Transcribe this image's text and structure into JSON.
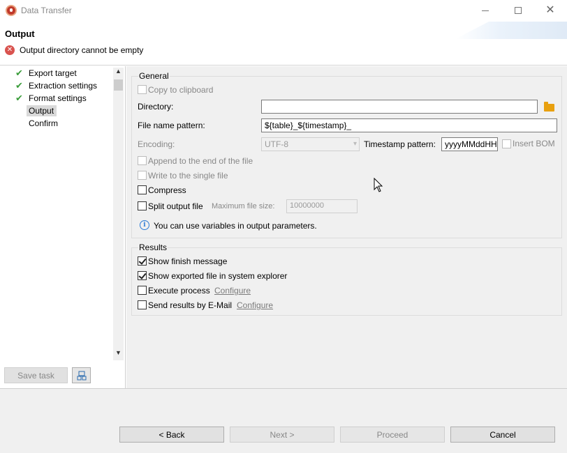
{
  "window": {
    "title": "Data Transfer"
  },
  "header": {
    "title": "Output",
    "error_message": "Output directory cannot be empty"
  },
  "nav": {
    "items": [
      {
        "label": "Export target",
        "checked": true,
        "selected": false
      },
      {
        "label": "Extraction settings",
        "checked": true,
        "selected": false
      },
      {
        "label": "Format settings",
        "checked": true,
        "selected": false
      },
      {
        "label": "Output",
        "checked": false,
        "selected": true
      },
      {
        "label": "Confirm",
        "checked": false,
        "selected": false
      }
    ]
  },
  "left_buttons": {
    "save_task": "Save task"
  },
  "general": {
    "title": "General",
    "copy_to_clipboard": "Copy to clipboard",
    "directory_label": "Directory:",
    "directory_value": "",
    "file_name_pattern_label": "File name pattern:",
    "file_name_pattern_value": "${table}_${timestamp}_",
    "encoding_label": "Encoding:",
    "encoding_value": "UTF-8",
    "timestamp_pattern_label": "Timestamp pattern:",
    "timestamp_pattern_value": "yyyyMMddHH",
    "insert_bom": "Insert BOM",
    "append_to_end": "Append to the end of the file",
    "write_single_file": "Write to the single file",
    "compress": "Compress",
    "split_output_file": "Split output file",
    "max_file_size_label": "Maximum file size:",
    "max_file_size_value": "10000000",
    "info_text": "You can use variables in output parameters."
  },
  "results": {
    "title": "Results",
    "show_finish_message": "Show finish message",
    "show_exported_file": "Show exported file in system explorer",
    "execute_process": "Execute process",
    "execute_configure": "Configure",
    "send_results_email": "Send results by E-Mail",
    "email_configure": "Configure"
  },
  "footer": {
    "back": "< Back",
    "next": "Next >",
    "proceed": "Proceed",
    "cancel": "Cancel"
  },
  "colors": {
    "check_green": "#3a9c3a",
    "error_red": "#d9534f",
    "folder_orange": "#e8a00f",
    "info_blue": "#2b7bd6"
  }
}
